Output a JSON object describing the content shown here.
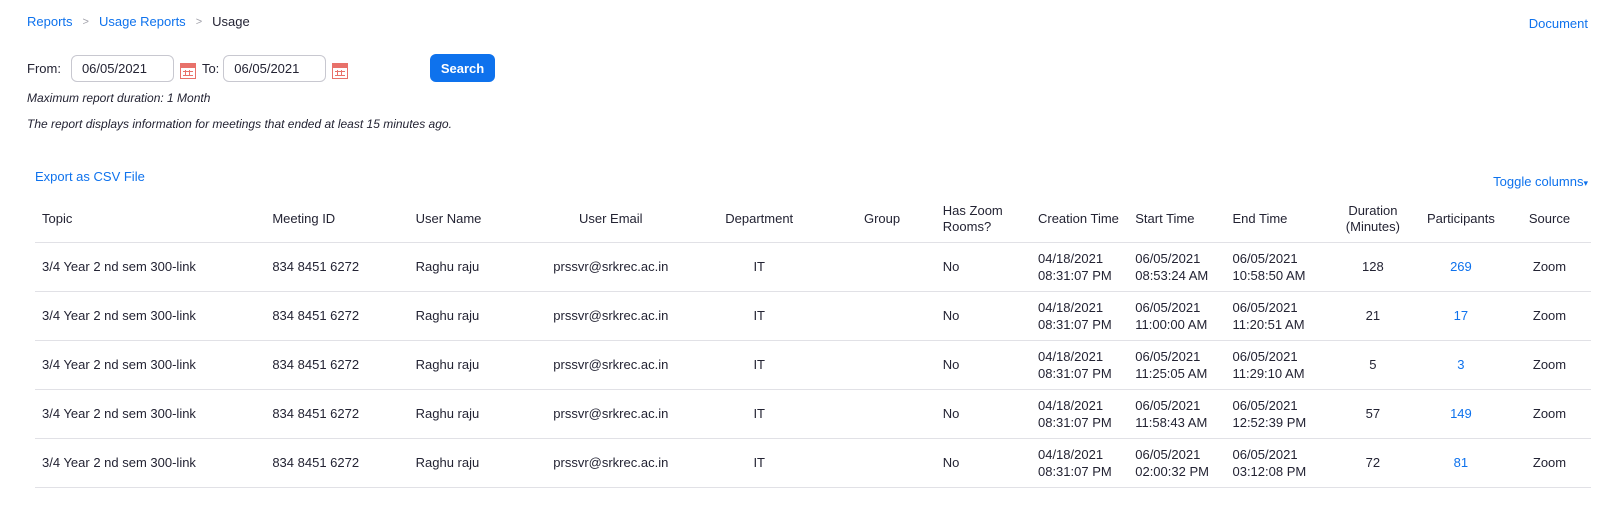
{
  "breadcrumb": {
    "reports": "Reports",
    "separator": ">",
    "usage_reports": "Usage Reports",
    "current": "Usage"
  },
  "document_link": "Document",
  "filter": {
    "from_label": "From:",
    "from_value": "06/05/2021",
    "to_label": "To:",
    "to_value": "06/05/2021",
    "calendar_icon": "calendar-icon",
    "search_label": "Search"
  },
  "notes": {
    "max_duration": "Maximum report duration: 1 Month",
    "info": "The report displays information for meetings that ended at least 15 minutes ago."
  },
  "export_label": "Export as CSV File",
  "toggle_columns": "Toggle columns",
  "colors": {
    "accent": "#0e72ed",
    "calendar": "#e8716a"
  },
  "table": {
    "headers": {
      "topic": "Topic",
      "meeting_id": "Meeting ID",
      "user_name": "User Name",
      "user_email": "User Email",
      "department": "Department",
      "group": "Group",
      "has_zoom_rooms_1": "Has Zoom",
      "has_zoom_rooms_2": "Rooms?",
      "creation_time": "Creation Time",
      "start_time": "Start Time",
      "end_time": "End Time",
      "duration_1": "Duration",
      "duration_2": "(Minutes)",
      "participants": "Participants",
      "source": "Source"
    },
    "rows": [
      {
        "topic": "3/4 Year 2 nd sem 300-link",
        "meeting_id": "834 8451 6272",
        "user_name": "Raghu raju",
        "user_email": "prssvr@srkrec.ac.in",
        "department": "IT",
        "group": "",
        "has_zoom_rooms": "No",
        "creation_date": "04/18/2021",
        "creation_time": "08:31:07 PM",
        "start_date": "06/05/2021",
        "start_time": "08:53:24 AM",
        "end_date": "06/05/2021",
        "end_time": "10:58:50 AM",
        "duration": "128",
        "participants": "269",
        "source": "Zoom"
      },
      {
        "topic": "3/4 Year 2 nd sem 300-link",
        "meeting_id": "834 8451 6272",
        "user_name": "Raghu raju",
        "user_email": "prssvr@srkrec.ac.in",
        "department": "IT",
        "group": "",
        "has_zoom_rooms": "No",
        "creation_date": "04/18/2021",
        "creation_time": "08:31:07 PM",
        "start_date": "06/05/2021",
        "start_time": "11:00:00 AM",
        "end_date": "06/05/2021",
        "end_time": "11:20:51 AM",
        "duration": "21",
        "participants": "17",
        "source": "Zoom"
      },
      {
        "topic": "3/4 Year 2 nd sem 300-link",
        "meeting_id": "834 8451 6272",
        "user_name": "Raghu raju",
        "user_email": "prssvr@srkrec.ac.in",
        "department": "IT",
        "group": "",
        "has_zoom_rooms": "No",
        "creation_date": "04/18/2021",
        "creation_time": "08:31:07 PM",
        "start_date": "06/05/2021",
        "start_time": "11:25:05 AM",
        "end_date": "06/05/2021",
        "end_time": "11:29:10 AM",
        "duration": "5",
        "participants": "3",
        "source": "Zoom"
      },
      {
        "topic": "3/4 Year 2 nd sem 300-link",
        "meeting_id": "834 8451 6272",
        "user_name": "Raghu raju",
        "user_email": "prssvr@srkrec.ac.in",
        "department": "IT",
        "group": "",
        "has_zoom_rooms": "No",
        "creation_date": "04/18/2021",
        "creation_time": "08:31:07 PM",
        "start_date": "06/05/2021",
        "start_time": "11:58:43 AM",
        "end_date": "06/05/2021",
        "end_time": "12:52:39 PM",
        "duration": "57",
        "participants": "149",
        "source": "Zoom"
      },
      {
        "topic": "3/4 Year 2 nd sem 300-link",
        "meeting_id": "834 8451 6272",
        "user_name": "Raghu raju",
        "user_email": "prssvr@srkrec.ac.in",
        "department": "IT",
        "group": "",
        "has_zoom_rooms": "No",
        "creation_date": "04/18/2021",
        "creation_time": "08:31:07 PM",
        "start_date": "06/05/2021",
        "start_time": "02:00:32 PM",
        "end_date": "06/05/2021",
        "end_time": "03:12:08 PM",
        "duration": "72",
        "participants": "81",
        "source": "Zoom"
      }
    ]
  }
}
